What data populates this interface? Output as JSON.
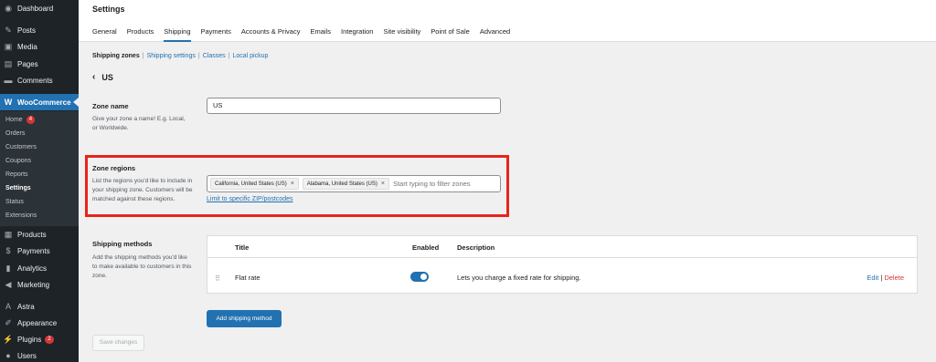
{
  "sidebar": {
    "items": [
      {
        "label": "Dashboard",
        "icon": "dashboard-icon",
        "glyph": "◉"
      },
      {
        "label": "Posts",
        "icon": "pin-icon",
        "glyph": "✎"
      },
      {
        "label": "Media",
        "icon": "media-icon",
        "glyph": "▣"
      },
      {
        "label": "Pages",
        "icon": "pages-icon",
        "glyph": "▤"
      },
      {
        "label": "Comments",
        "icon": "comments-icon",
        "glyph": "▬"
      },
      {
        "label": "WooCommerce",
        "icon": "woo-icon",
        "glyph": "W"
      }
    ],
    "submenu": [
      {
        "label": "Home",
        "badge": "4"
      },
      {
        "label": "Orders"
      },
      {
        "label": "Customers"
      },
      {
        "label": "Coupons"
      },
      {
        "label": "Reports"
      },
      {
        "label": "Settings"
      },
      {
        "label": "Status"
      },
      {
        "label": "Extensions"
      }
    ],
    "lower_items": [
      {
        "label": "Products",
        "icon": "products-icon",
        "glyph": "▦"
      },
      {
        "label": "Payments",
        "icon": "payments-icon",
        "glyph": "$"
      },
      {
        "label": "Analytics",
        "icon": "analytics-icon",
        "glyph": "▮"
      },
      {
        "label": "Marketing",
        "icon": "marketing-icon",
        "glyph": "◀"
      },
      {
        "label": "Astra",
        "icon": "astra-icon",
        "glyph": "A"
      },
      {
        "label": "Appearance",
        "icon": "appearance-icon",
        "glyph": "✐"
      },
      {
        "label": "Plugins",
        "icon": "plugins-icon",
        "glyph": "⚡",
        "badge": "2"
      },
      {
        "label": "Users",
        "icon": "users-icon",
        "glyph": "●"
      }
    ]
  },
  "header": {
    "title": "Settings",
    "tabs": [
      "General",
      "Products",
      "Shipping",
      "Payments",
      "Accounts & Privacy",
      "Emails",
      "Integration",
      "Site visibility",
      "Point of Sale",
      "Advanced"
    ]
  },
  "subnav": {
    "items": [
      "Shipping zones",
      "Shipping settings",
      "Classes",
      "Local pickup"
    ],
    "separator": "|"
  },
  "zone": {
    "back_label": "US",
    "name_title": "Zone name",
    "name_desc": "Give your zone a name! E.g. Local, or Worldwide.",
    "name_value": "US",
    "regions_title": "Zone regions",
    "regions_desc": "List the regions you'd like to include in your shipping zone. Customers will be matched against these regions.",
    "regions": [
      "California, United States (US)",
      "Alabama, United States (US)"
    ],
    "filter_placeholder": "Start typing to filter zones",
    "zip_link": "Limit to specific ZIP/postcodes"
  },
  "methods": {
    "title": "Shipping methods",
    "desc": "Add the shipping methods you'd like to make available to customers in this zone.",
    "columns": {
      "title": "Title",
      "enabled": "Enabled",
      "description": "Description"
    },
    "rows": [
      {
        "title": "Flat rate",
        "enabled": true,
        "description": "Lets you charge a fixed rate for shipping.",
        "edit": "Edit",
        "delete": "Delete"
      }
    ],
    "add_button": "Add shipping method"
  },
  "save_button": "Save changes",
  "colors": {
    "accent": "#2271b1",
    "highlight": "#e8231b",
    "sidebar": "#1d2327"
  }
}
